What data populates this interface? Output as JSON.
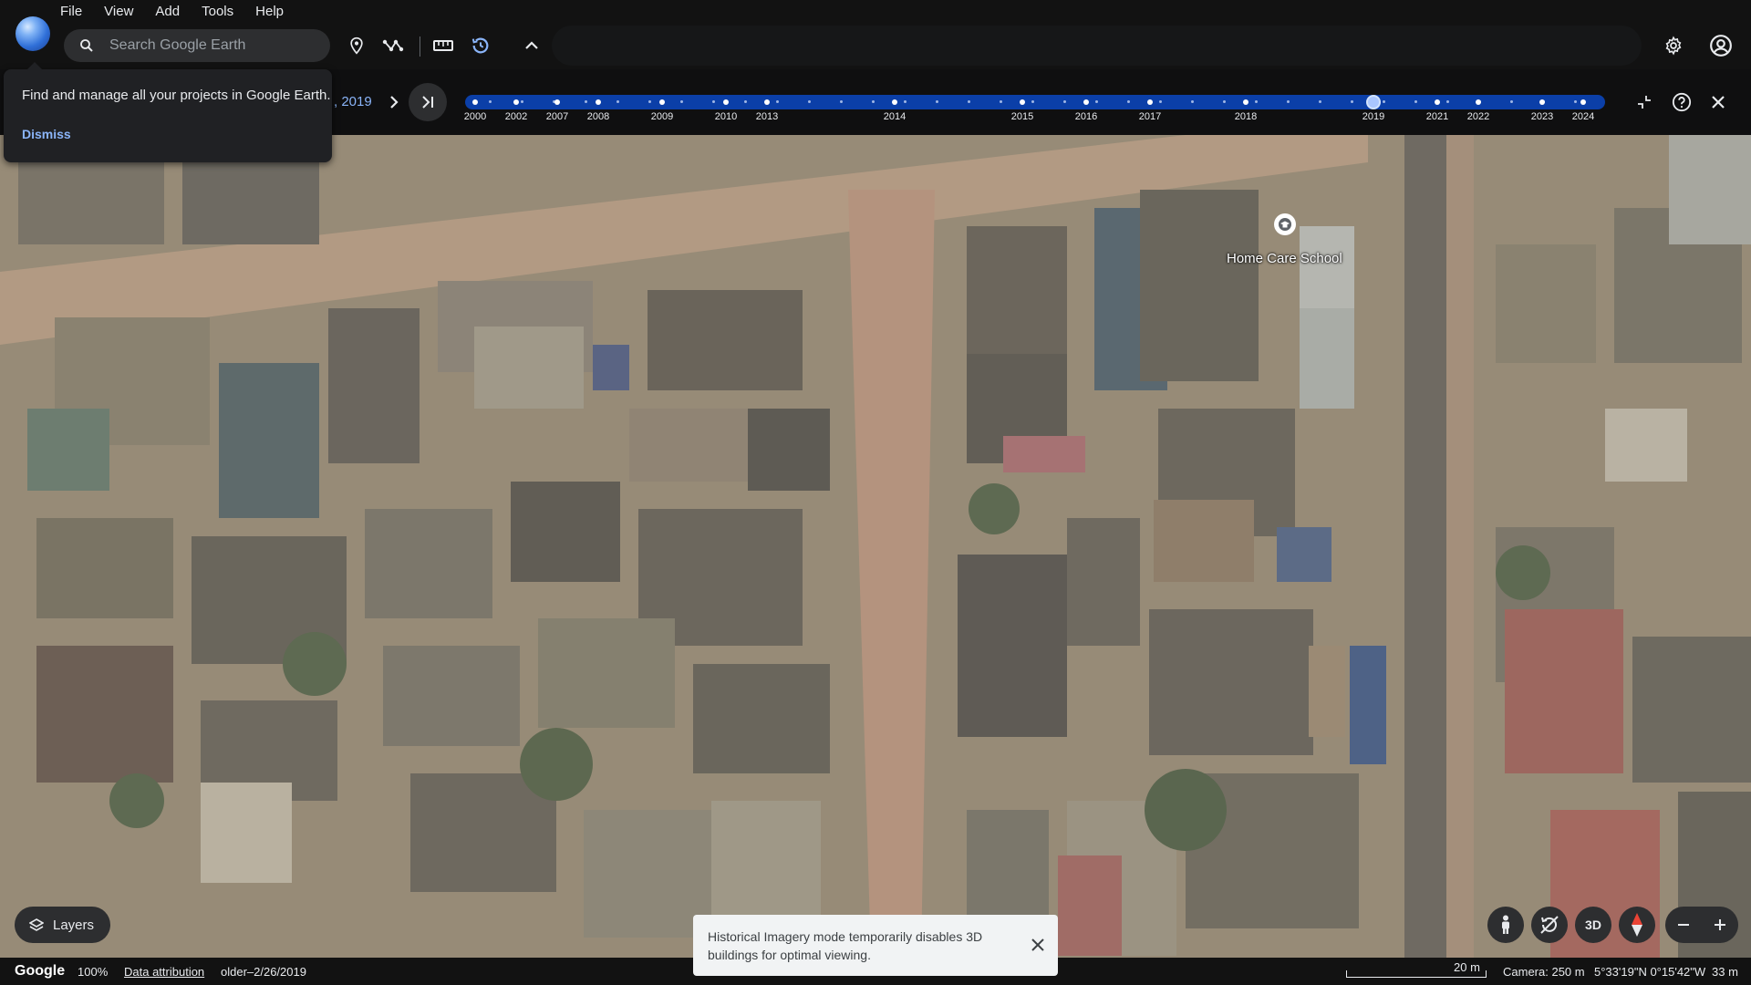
{
  "menu": {
    "items": [
      "File",
      "View",
      "Add",
      "Tools",
      "Help"
    ]
  },
  "search": {
    "placeholder": "Search Google Earth"
  },
  "popup": {
    "message": "Find and manage all your projects in Google Earth.",
    "dismiss_label": "Dismiss"
  },
  "timeline": {
    "current_date": ", 2019",
    "selected_year": "2019",
    "years": [
      "2000",
      "2002",
      "2007",
      "2008",
      "2009",
      "2010",
      "2013",
      "2014",
      "2015",
      "2016",
      "2017",
      "2018",
      "2019",
      "2021",
      "2022",
      "2023",
      "2024"
    ]
  },
  "map": {
    "place_label": "Home Care School"
  },
  "layers": {
    "label": "Layers"
  },
  "toast": {
    "message": "Historical Imagery mode temporarily disables 3D buildings for optimal viewing."
  },
  "controls": {
    "three_d_label": "3D"
  },
  "status": {
    "brand": "Google",
    "zoom": "100%",
    "attribution": "Data attribution",
    "imagery_date": "older–2/26/2019",
    "scale": "20 m",
    "camera": "Camera: 250 m",
    "coordinates": "5°33'19\"N 0°15'42\"W",
    "elevation": "33 m"
  },
  "colors": {
    "accent": "#8ab4f8",
    "track": "#0b3fa8",
    "toolbar_bg": "#121212"
  }
}
